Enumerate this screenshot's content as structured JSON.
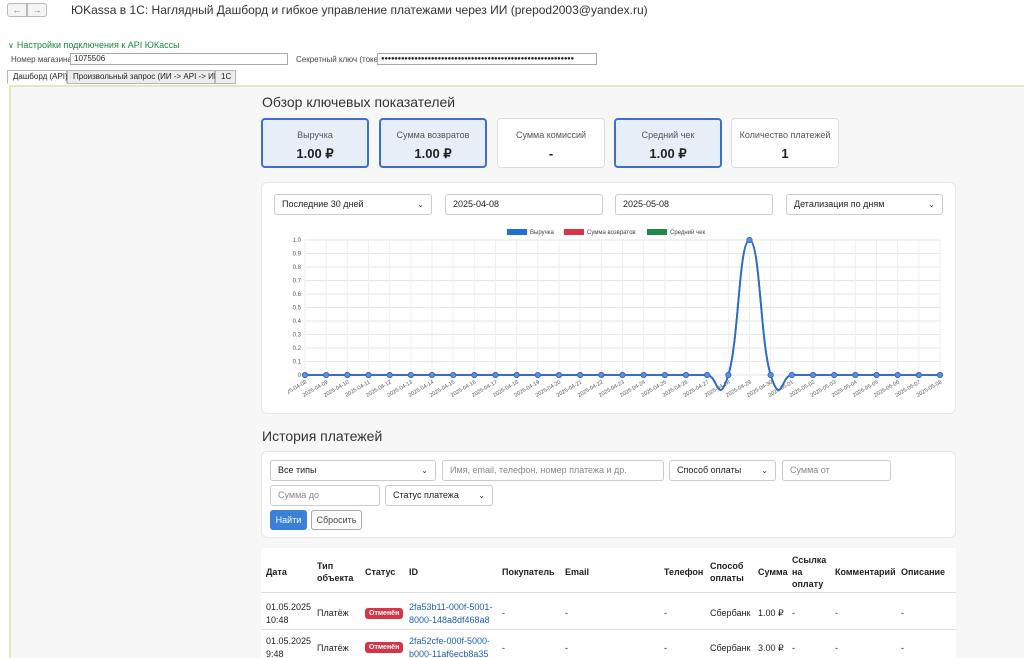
{
  "window": {
    "title": "ЮKassa в 1С: Наглядный Дашборд и гибкое управление платежами через ИИ (prepod2003@yandex.ru)",
    "back_glyph": "←",
    "forward_glyph": "→"
  },
  "settings": {
    "section_label": "Настройки подключения к API ЮКассы",
    "shop_label": "Номер магазина:",
    "shop_value": "1075506",
    "secret_label": "Секретный ключ (токен):",
    "secret_value": "●●●●●●●●●●●●●●●●●●●●●●●●●●●●●●●●●●●●●●●●●●●●●●●●●●●●●●●●●●"
  },
  "tabs": [
    {
      "label": "Дашборд (API)",
      "active": true
    },
    {
      "label": "Произвольный запрос (ИИ -> API -> ИИ)",
      "active": false
    },
    {
      "label": "1С",
      "active": false
    }
  ],
  "overview": {
    "title": "Обзор ключевых показателей",
    "kpis": [
      {
        "label": "Выручка",
        "value": "1.00 ₽",
        "highlighted": true
      },
      {
        "label": "Сумма возвратов",
        "value": "1.00 ₽",
        "highlighted": true
      },
      {
        "label": "Сумма комиссий",
        "value": "-",
        "highlighted": false
      },
      {
        "label": "Средний чек",
        "value": "1.00 ₽",
        "highlighted": true
      },
      {
        "label": "Количество платежей",
        "value": "1",
        "highlighted": false
      }
    ]
  },
  "chart_controls": {
    "period": "Последние 30 дней",
    "date_from": "2025-04-08",
    "date_to": "2025-05-08",
    "detail": "Детализация по дням"
  },
  "chart_data": {
    "type": "line",
    "x": [
      "2025-04-08",
      "2025-04-09",
      "2025-04-10",
      "2025-04-11",
      "2025-04-12",
      "2025-04-13",
      "2025-04-14",
      "2025-04-15",
      "2025-04-16",
      "2025-04-17",
      "2025-04-18",
      "2025-04-19",
      "2025-04-20",
      "2025-04-21",
      "2025-04-22",
      "2025-04-23",
      "2025-04-24",
      "2025-04-25",
      "2025-04-26",
      "2025-04-27",
      "2025-04-28",
      "2025-04-29",
      "2025-04-30",
      "2025-05-01",
      "2025-05-02",
      "2025-05-03",
      "2025-05-04",
      "2025-05-05",
      "2025-05-06",
      "2025-05-07",
      "2025-05-08"
    ],
    "series": [
      {
        "name": "Выручка",
        "color": "#1f6fd6",
        "values": [
          0,
          0,
          0,
          0,
          0,
          0,
          0,
          0,
          0,
          0,
          0,
          0,
          0,
          0,
          0,
          0,
          0,
          0,
          0,
          0,
          0,
          1,
          0,
          0,
          0,
          0,
          0,
          0,
          0,
          0,
          0
        ]
      },
      {
        "name": "Сумма возвратов",
        "color": "#dc3545",
        "values": [
          0,
          0,
          0,
          0,
          0,
          0,
          0,
          0,
          0,
          0,
          0,
          0,
          0,
          0,
          0,
          0,
          0,
          0,
          0,
          0,
          0,
          1,
          0,
          0,
          0,
          0,
          0,
          0,
          0,
          0,
          0
        ]
      },
      {
        "name": "Средний чек",
        "color": "#1e8a4c",
        "values": [
          0,
          0,
          0,
          0,
          0,
          0,
          0,
          0,
          0,
          0,
          0,
          0,
          0,
          0,
          0,
          0,
          0,
          0,
          0,
          0,
          0,
          1,
          0,
          0,
          0,
          0,
          0,
          0,
          0,
          0,
          0
        ]
      }
    ],
    "yticks": [
      "0",
      "0.1",
      "0.2",
      "0.3",
      "0.4",
      "0.5",
      "0.6",
      "0.7",
      "0.8",
      "0.9",
      "1.0"
    ],
    "ylim": [
      0,
      1
    ],
    "grid": true,
    "legend": "top-center"
  },
  "history": {
    "title": "История платежей",
    "filters": {
      "type": "Все типы",
      "search_placeholder": "Имя, email, телефон, номер платежа и др.",
      "method": "Способ оплаты",
      "amount_from_placeholder": "Сумма от",
      "amount_to_placeholder": "Сумма до",
      "status": "Статус платежа",
      "find": "Найти",
      "reset": "Сбросить"
    },
    "columns": [
      "Дата",
      "Тип объекта",
      "Статус",
      "ID",
      "Покупатель",
      "Email",
      "Телефон",
      "Способ оплаты",
      "Сумма",
      "Ссылка на оплату",
      "Комментарий",
      "Описание"
    ],
    "rows": [
      {
        "date1": "01.05.2025",
        "date2": "10:48",
        "type": "Платёж",
        "status": "Отменён",
        "id1": "2fa53b11-000f-5001-",
        "id2": "8000-148a8df468a8",
        "buyer": "-",
        "email": "-",
        "phone": "-",
        "method": "Сбербанк",
        "amount": "1.00 ₽",
        "link": "-",
        "comment": "-",
        "description": "-"
      },
      {
        "date1": "01.05.2025",
        "date2": "9:48",
        "type": "Платёж",
        "status": "Отменён",
        "id1": "2fa52cfe-000f-5000-",
        "id2": "b000-11af6ecb8a35",
        "buyer": "-",
        "email": "-",
        "phone": "-",
        "method": "Сбербанк",
        "amount": "3.00 ₽",
        "link": "-",
        "comment": "-",
        "description": "-"
      }
    ]
  }
}
